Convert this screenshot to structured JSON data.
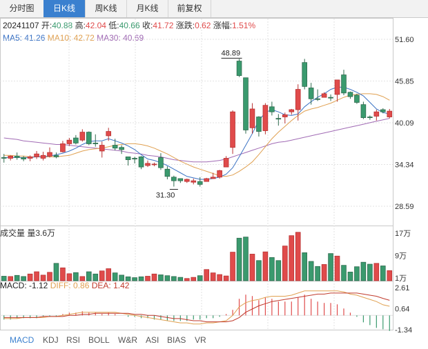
{
  "tabs": [
    "分时图",
    "日K线",
    "周K线",
    "月K线",
    "前复权"
  ],
  "active_tab": 1,
  "quote": {
    "date": "20241107",
    "open_label": "开:",
    "open": "40.88",
    "high_label": "高:",
    "high": "42.04",
    "low_label": "低:",
    "low": "40.66",
    "close_label": "收:",
    "close": "41.72",
    "change_label": "涨跌:",
    "change": "0.62",
    "pct_label": "涨幅:",
    "pct": "1.51%"
  },
  "ma": {
    "ma5": "MA5: 41.26",
    "ma10": "MA10: 42.72",
    "ma30": "MA30: 40.69"
  },
  "price_axis": [
    "51.60",
    "45.85",
    "40.09",
    "34.34",
    "28.59"
  ],
  "price_marks": {
    "high": "48.89",
    "low": "31.30"
  },
  "volume": {
    "label": "成交量 量3.6万",
    "axis": [
      "17万",
      "9万",
      "1万"
    ]
  },
  "macd": {
    "macd": "MACD: -1.12",
    "diff": "DIFF: 0.86",
    "dea": "DEA: 1.42",
    "axis": [
      "2.61",
      "0.64",
      "-1.34"
    ]
  },
  "indicator_tabs": [
    "MACD",
    "KDJ",
    "RSI",
    "BOLL",
    "W&R",
    "ASI",
    "BIAS",
    "VR"
  ],
  "active_indicator": 0,
  "colors": {
    "up": "#e04b4b",
    "down": "#3a9a6e",
    "ma5": "#3a72c4",
    "ma10": "#e0a050",
    "ma30": "#a06ab4",
    "accent": "#3a80cf"
  },
  "chart_data": {
    "type": "candlestick",
    "candles": [
      [
        35.3,
        35.8,
        34.6,
        35.2
      ],
      [
        35.2,
        35.6,
        34.9,
        35.5
      ],
      [
        35.5,
        36.0,
        35.0,
        35.3
      ],
      [
        35.3,
        35.5,
        34.8,
        35.1
      ],
      [
        35.2,
        35.6,
        34.8,
        35.4
      ],
      [
        35.4,
        36.2,
        35.1,
        35.8
      ],
      [
        35.2,
        36.1,
        34.9,
        35.6
      ],
      [
        35.5,
        36.7,
        35.3,
        36.0
      ],
      [
        35.6,
        36.0,
        35.2,
        35.4
      ],
      [
        36.1,
        37.6,
        36.0,
        37.2
      ],
      [
        37.2,
        38.0,
        36.9,
        37.7
      ],
      [
        38.0,
        38.4,
        37.1,
        37.3
      ],
      [
        37.7,
        39.2,
        37.5,
        38.8
      ],
      [
        38.8,
        38.9,
        37.0,
        37.2
      ],
      [
        37.3,
        38.5,
        36.8,
        37.2
      ],
      [
        36.2,
        37.5,
        35.3,
        37.0
      ],
      [
        38.3,
        39.4,
        37.6,
        38.9
      ],
      [
        37.0,
        37.9,
        36.3,
        36.6
      ],
      [
        36.7,
        37.0,
        35.8,
        36.4
      ],
      [
        35.4,
        35.4,
        34.2,
        35.0
      ],
      [
        35.2,
        35.4,
        34.5,
        35.1
      ],
      [
        35.4,
        35.5,
        33.7,
        34.0
      ],
      [
        34.2,
        34.9,
        34.0,
        34.5
      ],
      [
        34.4,
        34.6,
        34.1,
        34.4
      ],
      [
        35.3,
        35.9,
        33.6,
        33.9
      ],
      [
        33.7,
        34.1,
        32.3,
        32.7
      ],
      [
        32.6,
        32.8,
        31.3,
        32.1
      ],
      [
        32.4,
        32.4,
        31.8,
        32.1
      ],
      [
        32.0,
        32.4,
        31.8,
        32.3
      ],
      [
        31.9,
        32.4,
        31.6,
        32.1
      ],
      [
        32.0,
        32.6,
        31.3,
        31.6
      ],
      [
        32.0,
        32.5,
        32.1,
        32.4
      ],
      [
        32.4,
        33.2,
        32.4,
        32.6
      ],
      [
        32.6,
        33.6,
        32.4,
        33.5
      ],
      [
        34.0,
        35.5,
        34.0,
        35.2
      ],
      [
        36.7,
        41.8,
        35.8,
        41.6
      ],
      [
        48.6,
        48.9,
        46.4,
        46.6
      ],
      [
        46.3,
        46.3,
        38.6,
        39.1
      ],
      [
        39.4,
        42.8,
        38.6,
        42.0
      ],
      [
        40.9,
        41.0,
        38.2,
        38.9
      ],
      [
        39.0,
        42.8,
        38.5,
        42.5
      ],
      [
        42.3,
        43.0,
        41.1,
        41.6
      ],
      [
        40.7,
        41.3,
        39.7,
        40.6
      ],
      [
        40.9,
        41.5,
        40.0,
        41.2
      ],
      [
        41.6,
        42.0,
        41.2,
        41.9
      ],
      [
        41.9,
        45.4,
        40.4,
        44.7
      ],
      [
        48.4,
        48.9,
        44.7,
        45.1
      ],
      [
        44.9,
        45.6,
        42.6,
        43.4
      ],
      [
        43.4,
        44.7,
        43.1,
        43.3
      ],
      [
        43.6,
        44.3,
        43.7,
        44.1
      ],
      [
        43.6,
        44.0,
        43.1,
        43.5
      ],
      [
        44.0,
        46.0,
        43.0,
        46.0
      ],
      [
        46.7,
        47.4,
        43.9,
        44.2
      ],
      [
        44.3,
        44.4,
        43.4,
        43.7
      ],
      [
        43.9,
        44.1,
        42.7,
        42.9
      ],
      [
        42.6,
        43.0,
        40.6,
        40.8
      ],
      [
        40.9,
        41.1,
        40.5,
        40.8
      ],
      [
        41.0,
        41.9,
        40.4,
        41.6
      ],
      [
        41.9,
        42.1,
        41.4,
        41.6
      ],
      [
        40.9,
        42.0,
        40.7,
        41.7
      ]
    ],
    "ma5": [
      35.3,
      35.3,
      35.3,
      35.3,
      35.3,
      35.4,
      35.4,
      35.5,
      35.7,
      35.9,
      36.2,
      36.6,
      37.1,
      37.5,
      37.6,
      37.6,
      37.9,
      37.6,
      37.3,
      36.9,
      36.4,
      35.7,
      35.1,
      34.9,
      34.6,
      34.2,
      33.7,
      33.2,
      32.7,
      32.5,
      32.3,
      32.3,
      32.4,
      32.6,
      33.0,
      33.9,
      35.4,
      37.0,
      38.6,
      40.4,
      41.5,
      41.9,
      41.6,
      41.2,
      41.1,
      41.3,
      42.3,
      43.0,
      43.6,
      44.1,
      44.7,
      45.0,
      45.0,
      44.7,
      44.3,
      43.8,
      42.9,
      42.0,
      41.5,
      41.3
    ],
    "ma10": [
      35.6,
      35.6,
      35.5,
      35.5,
      35.4,
      35.4,
      35.4,
      35.4,
      35.4,
      35.5,
      35.6,
      35.9,
      36.2,
      36.4,
      36.5,
      36.6,
      36.8,
      37.0,
      37.1,
      37.2,
      37.2,
      37.1,
      36.9,
      36.6,
      36.2,
      35.8,
      35.3,
      34.8,
      34.4,
      34.0,
      33.7,
      33.4,
      33.1,
      32.8,
      32.7,
      32.9,
      33.4,
      34.0,
      34.7,
      35.7,
      36.8,
      37.9,
      38.8,
      39.6,
      40.4,
      41.1,
      41.7,
      42.0,
      42.2,
      42.5,
      42.8,
      43.2,
      43.6,
      43.9,
      44.0,
      44.1,
      44.1,
      44.0,
      43.7,
      43.2
    ],
    "ma30": [
      38.0,
      37.9,
      37.8,
      37.6,
      37.5,
      37.4,
      37.3,
      37.2,
      37.1,
      37.1,
      37.0,
      36.9,
      36.8,
      36.7,
      36.6,
      36.5,
      36.4,
      36.3,
      36.2,
      36.0,
      35.9,
      35.8,
      35.6,
      35.5,
      35.4,
      35.2,
      35.0,
      34.9,
      34.8,
      34.7,
      34.7,
      34.7,
      34.8,
      34.9,
      35.1,
      35.4,
      35.7,
      36.0,
      36.3,
      36.6,
      36.9,
      37.2,
      37.4,
      37.5,
      37.7,
      37.9,
      38.1,
      38.3,
      38.5,
      38.7,
      38.9,
      39.1,
      39.3,
      39.5,
      39.7,
      39.9,
      40.1,
      40.3,
      40.5,
      40.7
    ],
    "volume_wan": [
      1.6,
      1.5,
      1.9,
      1.5,
      2.4,
      3.2,
      2.0,
      3.0,
      6.2,
      4.6,
      2.5,
      2.9,
      1.5,
      3.2,
      2.4,
      3.5,
      4.3,
      2.8,
      2.0,
      1.4,
      1.1,
      1.4,
      1.6,
      2.4,
      2.1,
      1.8,
      1.5,
      1.2,
      0.8,
      1.2,
      1.8,
      4.0,
      2.8,
      2.2,
      1.7,
      10.2,
      15.2,
      15.6,
      9.5,
      7.2,
      10.3,
      8.3,
      7.2,
      12.4,
      16.1,
      17.3,
      10.0,
      6.9,
      5.1,
      5.8,
      9.7,
      8.8,
      5.5,
      3.1,
      5.0,
      6.6,
      5.9,
      6.2,
      5.3,
      3.6
    ],
    "macd_hist": [
      -0.3,
      -0.3,
      -0.2,
      -0.2,
      -0.2,
      -0.2,
      -0.1,
      -0.1,
      -0.1,
      0.1,
      0.2,
      0.2,
      0.3,
      0.2,
      0.2,
      0.1,
      0.2,
      0.1,
      0.0,
      -0.1,
      -0.1,
      -0.2,
      -0.2,
      -0.3,
      -0.3,
      -0.4,
      -0.4,
      -0.4,
      -0.4,
      -0.3,
      -0.3,
      -0.2,
      -0.2,
      -0.1,
      0.1,
      0.4,
      1.2,
      1.5,
      1.4,
      1.1,
      1.3,
      1.2,
      1.0,
      1.0,
      1.0,
      1.3,
      1.5,
      1.2,
      1.0,
      0.9,
      0.9,
      0.8,
      0.5,
      0.2,
      -0.1,
      -0.5,
      -0.7,
      -0.9,
      -1.0,
      -1.12
    ],
    "diff": [
      -0.3,
      -0.3,
      -0.3,
      -0.2,
      -0.2,
      -0.2,
      -0.2,
      -0.1,
      -0.1,
      0.0,
      0.1,
      0.2,
      0.3,
      0.3,
      0.3,
      0.3,
      0.3,
      0.3,
      0.2,
      0.1,
      0.0,
      -0.1,
      -0.2,
      -0.3,
      -0.4,
      -0.5,
      -0.6,
      -0.7,
      -0.7,
      -0.8,
      -0.8,
      -0.7,
      -0.7,
      -0.6,
      -0.5,
      0.0,
      0.8,
      1.2,
      1.4,
      1.5,
      1.7,
      1.8,
      1.8,
      1.8,
      1.9,
      2.1,
      2.3,
      2.3,
      2.3,
      2.3,
      2.3,
      2.3,
      2.2,
      2.0,
      1.9,
      1.7,
      1.5,
      1.3,
      1.0,
      0.86
    ],
    "dea": [
      -0.2,
      -0.2,
      -0.2,
      -0.2,
      -0.2,
      -0.2,
      -0.1,
      -0.1,
      -0.1,
      -0.1,
      0.0,
      0.0,
      0.1,
      0.1,
      0.2,
      0.2,
      0.2,
      0.2,
      0.2,
      0.2,
      0.1,
      0.1,
      0.0,
      0.0,
      -0.1,
      -0.2,
      -0.3,
      -0.3,
      -0.4,
      -0.5,
      -0.5,
      -0.6,
      -0.6,
      -0.6,
      -0.6,
      -0.5,
      -0.2,
      0.3,
      0.6,
      0.9,
      1.1,
      1.3,
      1.4,
      1.5,
      1.6,
      1.7,
      1.8,
      1.9,
      2.0,
      2.0,
      2.1,
      2.1,
      2.1,
      2.1,
      2.1,
      2.0,
      1.9,
      1.8,
      1.6,
      1.42
    ]
  }
}
